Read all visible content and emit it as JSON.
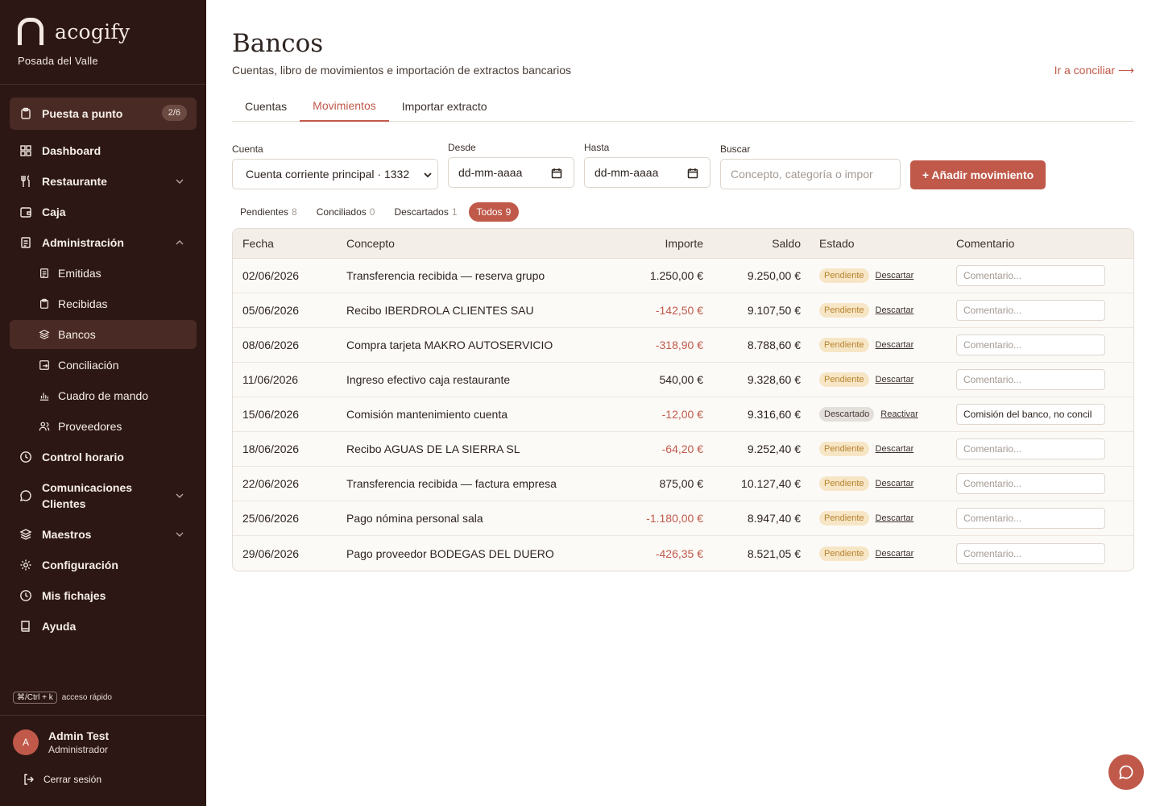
{
  "brand": {
    "name": "acogify",
    "property": "Posada del Valle"
  },
  "sidebar": {
    "setup": {
      "label": "Puesta a punto",
      "progress": "2/6"
    },
    "items": [
      {
        "label": "Dashboard",
        "icon": "grid-icon"
      },
      {
        "label": "Restaurante",
        "icon": "utensils-icon"
      },
      {
        "label": "Caja",
        "icon": "wallet-icon"
      },
      {
        "label": "Administración",
        "icon": "document-icon"
      },
      {
        "label": "Emitidas",
        "icon": "document-icon"
      },
      {
        "label": "Recibidas",
        "icon": "clipboard-icon"
      },
      {
        "label": "Bancos",
        "icon": "layers-icon"
      },
      {
        "label": "Conciliación",
        "icon": "reconcile-icon"
      },
      {
        "label": "Cuadro de mando",
        "icon": "bar-chart-icon"
      },
      {
        "label": "Proveedores",
        "icon": "users-icon"
      },
      {
        "label": "Control horario",
        "icon": "clock-icon"
      },
      {
        "label": "Comunicaciones Clientes",
        "icon": "chat-icon"
      },
      {
        "label": "Maestros",
        "icon": "layers-icon"
      },
      {
        "label": "Configuración",
        "icon": "gear-icon"
      },
      {
        "label": "Mis fichajes",
        "icon": "clock-icon"
      },
      {
        "label": "Ayuda",
        "icon": "book-icon"
      }
    ],
    "shortcut": {
      "key": "⌘/Ctrl + k",
      "label": "acceso rápido"
    },
    "user": {
      "initial": "A",
      "name": "Admin Test",
      "role": "Administrador"
    },
    "logout": "Cerrar sesión"
  },
  "page": {
    "title": "Bancos",
    "subtitle": "Cuentas, libro de movimientos e importación de extractos bancarios",
    "concile_link": "Ir a conciliar ⟶"
  },
  "tabs": [
    {
      "label": "Cuentas"
    },
    {
      "label": "Movimientos"
    },
    {
      "label": "Importar extracto"
    }
  ],
  "filters": {
    "account": {
      "label": "Cuenta",
      "value": "Cuenta corriente principal · 1332"
    },
    "from": {
      "label": "Desde",
      "placeholder": "dd-mm-aaaa"
    },
    "to": {
      "label": "Hasta",
      "placeholder": "dd-mm-aaaa"
    },
    "search": {
      "label": "Buscar",
      "placeholder": "Concepto, categoría o impor"
    },
    "add_button": "+ Añadir movimiento"
  },
  "status_filters": [
    {
      "label": "Pendientes",
      "count": "8"
    },
    {
      "label": "Conciliados",
      "count": "0"
    },
    {
      "label": "Descartados",
      "count": "1"
    },
    {
      "label": "Todos",
      "count": "9"
    }
  ],
  "table": {
    "columns": [
      "Fecha",
      "Concepto",
      "Importe",
      "Saldo",
      "Estado",
      "Comentario"
    ],
    "comment_placeholder": "Comentario...",
    "rows": [
      {
        "date": "02/06/2026",
        "concept": "Transferencia recibida — reserva grupo",
        "amount": "1.250,00 €",
        "balance": "9.250,00 €",
        "status": "Pendiente",
        "action": "Descartar",
        "comment": ""
      },
      {
        "date": "05/06/2026",
        "concept": "Recibo IBERDROLA CLIENTES SAU",
        "amount": "-142,50 €",
        "balance": "9.107,50 €",
        "status": "Pendiente",
        "action": "Descartar",
        "comment": ""
      },
      {
        "date": "08/06/2026",
        "concept": "Compra tarjeta MAKRO AUTOSERVICIO",
        "amount": "-318,90 €",
        "balance": "8.788,60 €",
        "status": "Pendiente",
        "action": "Descartar",
        "comment": ""
      },
      {
        "date": "11/06/2026",
        "concept": "Ingreso efectivo caja restaurante",
        "amount": "540,00 €",
        "balance": "9.328,60 €",
        "status": "Pendiente",
        "action": "Descartar",
        "comment": ""
      },
      {
        "date": "15/06/2026",
        "concept": "Comisión mantenimiento cuenta",
        "amount": "-12,00 €",
        "balance": "9.316,60 €",
        "status": "Descartado",
        "action": "Reactivar",
        "comment": "Comisión del banco, no concil"
      },
      {
        "date": "18/06/2026",
        "concept": "Recibo AGUAS DE LA SIERRA SL",
        "amount": "-64,20 €",
        "balance": "9.252,40 €",
        "status": "Pendiente",
        "action": "Descartar",
        "comment": ""
      },
      {
        "date": "22/06/2026",
        "concept": "Transferencia recibida — factura empresa",
        "amount": "875,00 €",
        "balance": "10.127,40 €",
        "status": "Pendiente",
        "action": "Descartar",
        "comment": ""
      },
      {
        "date": "25/06/2026",
        "concept": "Pago nómina personal sala",
        "amount": "-1.180,00 €",
        "balance": "8.947,40 €",
        "status": "Pendiente",
        "action": "Descartar",
        "comment": ""
      },
      {
        "date": "29/06/2026",
        "concept": "Pago proveedor BODEGAS DEL DUERO",
        "amount": "-426,35 €",
        "balance": "8.521,05 €",
        "status": "Pendiente",
        "action": "Descartar",
        "comment": ""
      }
    ]
  },
  "colors": {
    "accent": "#c0594a",
    "sidebar": "#2c1714",
    "pending": "#b7832e"
  }
}
